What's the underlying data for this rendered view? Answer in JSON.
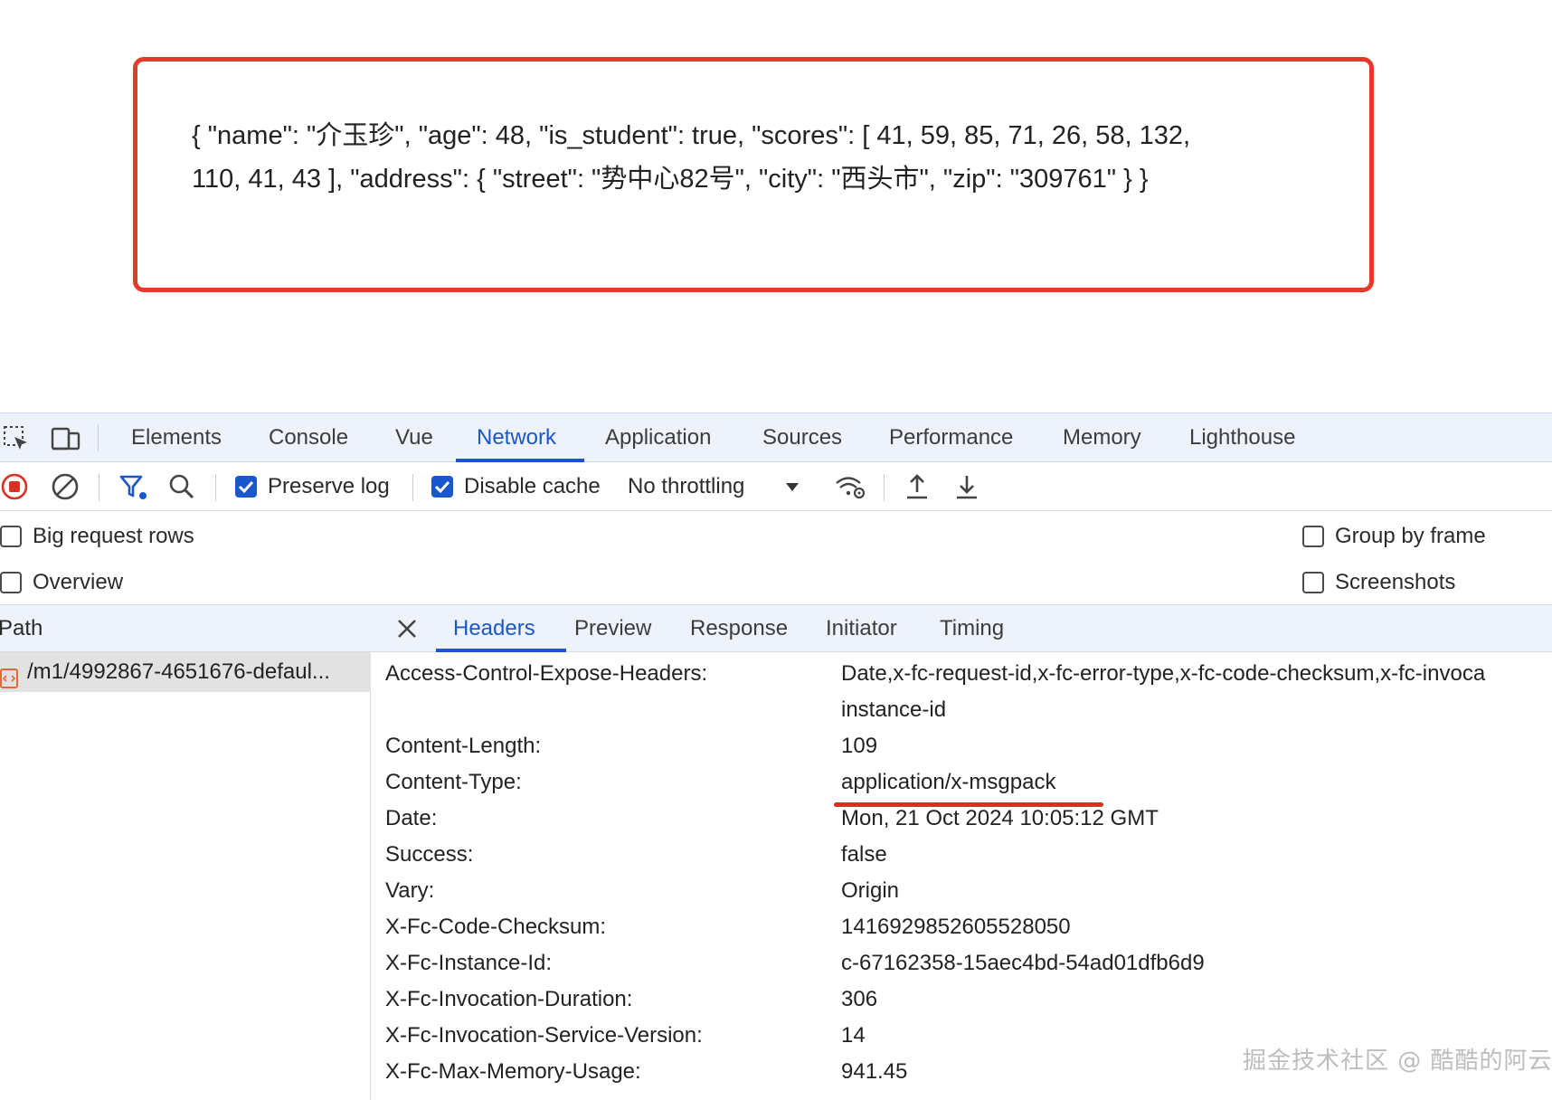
{
  "page": {
    "json_line1": "{ \"name\": \"介玉珍\", \"age\": 48, \"is_student\": true, \"scores\": [ 41, 59, 85, 71, 26, 58, 132,",
    "json_line2": "110, 41, 43 ], \"address\": { \"street\": \"势中心82号\", \"city\": \"西头市\", \"zip\": \"309761\" } }"
  },
  "devtools": {
    "tabs": [
      "Elements",
      "Console",
      "Vue",
      "Network",
      "Application",
      "Sources",
      "Performance",
      "Memory",
      "Lighthouse"
    ],
    "active_tab": "Network",
    "toolbar": {
      "preserve_log_label": "Preserve log",
      "preserve_log_checked": true,
      "disable_cache_label": "Disable cache",
      "disable_cache_checked": true,
      "throttling_value": "No throttling"
    },
    "options": {
      "big_request_rows": "Big request rows",
      "overview": "Overview",
      "group_by_frame": "Group by frame",
      "screenshots": "Screenshots"
    },
    "request_list": {
      "column_header": "Path",
      "rows": [
        "/m1/4992867-4651676-defaul..."
      ]
    },
    "detail_tabs": [
      "Headers",
      "Preview",
      "Response",
      "Initiator",
      "Timing"
    ],
    "active_detail_tab": "Headers",
    "headers": [
      {
        "name": "Access-Control-Expose-Headers:",
        "value": "Date,x-fc-request-id,x-fc-error-type,x-fc-code-checksum,x-fc-invoca",
        "value2": "instance-id"
      },
      {
        "name": "Content-Length:",
        "value": "109"
      },
      {
        "name": "Content-Type:",
        "value": "application/x-msgpack"
      },
      {
        "name": "Date:",
        "value": "Mon, 21 Oct 2024 10:05:12 GMT"
      },
      {
        "name": "Success:",
        "value": "false"
      },
      {
        "name": "Vary:",
        "value": "Origin"
      },
      {
        "name": "X-Fc-Code-Checksum:",
        "value": "1416929852605528050"
      },
      {
        "name": "X-Fc-Instance-Id:",
        "value": "c-67162358-15aec4bd-54ad01dfb6d9"
      },
      {
        "name": "X-Fc-Invocation-Duration:",
        "value": "306"
      },
      {
        "name": "X-Fc-Invocation-Service-Version:",
        "value": "14"
      },
      {
        "name": "X-Fc-Max-Memory-Usage:",
        "value": "941.45"
      }
    ]
  },
  "watermark": "掘金技术社区 @ 酷酷的阿云",
  "colors": {
    "accent": "#1a57c9",
    "highlight_border": "#e53a2a",
    "record_red": "#d93025"
  }
}
